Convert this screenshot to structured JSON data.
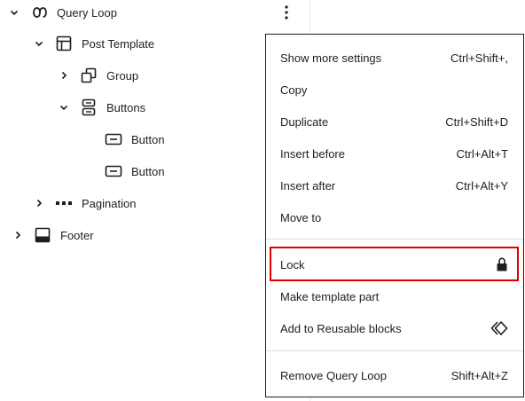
{
  "tree": {
    "query_loop": "Query Loop",
    "post_template": "Post Template",
    "group": "Group",
    "buttons": "Buttons",
    "button_1": "Button",
    "button_2": "Button",
    "pagination": "Pagination",
    "footer": "Footer"
  },
  "menu": {
    "show_more_settings": {
      "label": "Show more settings",
      "shortcut": "Ctrl+Shift+,"
    },
    "copy": {
      "label": "Copy"
    },
    "duplicate": {
      "label": "Duplicate",
      "shortcut": "Ctrl+Shift+D"
    },
    "insert_before": {
      "label": "Insert before",
      "shortcut": "Ctrl+Alt+T"
    },
    "insert_after": {
      "label": "Insert after",
      "shortcut": "Ctrl+Alt+Y"
    },
    "move_to": {
      "label": "Move to"
    },
    "lock": {
      "label": "Lock",
      "icon": "lock-icon"
    },
    "make_template_part": {
      "label": "Make template part"
    },
    "add_reusable": {
      "label": "Add to Reusable blocks",
      "icon": "reusable-icon"
    },
    "remove": {
      "label": "Remove Query Loop",
      "shortcut": "Shift+Alt+Z"
    }
  },
  "colors": {
    "highlight": "#e00000",
    "text": "#1e1e1e"
  }
}
